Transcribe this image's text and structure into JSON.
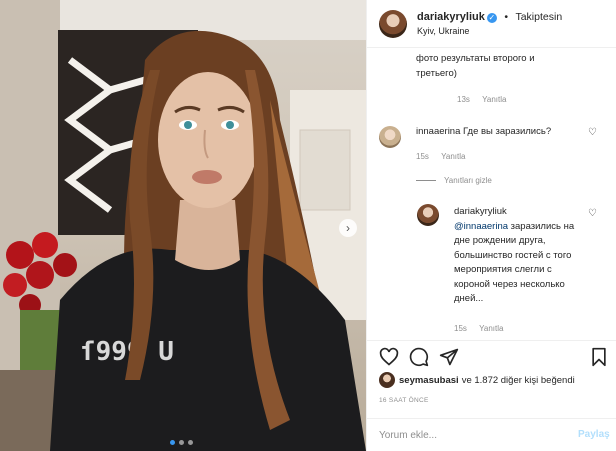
{
  "post": {
    "author": "dariakyryliuk",
    "follow_status": "Takiptesin",
    "location": "Kyiv, Ukraine"
  },
  "comments": [
    {
      "text": "фото результаты второго и третьего)",
      "time": "13s",
      "reply": "Yanıtla"
    },
    {
      "author": "innaaerina",
      "text": "Где вы заразились?",
      "time": "15s",
      "reply": "Yanıtla"
    }
  ],
  "hide_replies": "Yanıtları gizle",
  "reply_comment": {
    "author": "dariakyryliuk",
    "mention": "@innaaerina",
    "text": "заразились на дне рождении друга, большинство гостей с того мероприятия слегли с короной через несколько дней...",
    "time": "15s",
    "reply": "Yanıtla"
  },
  "likes": {
    "user": "seymasubasi",
    "text": "ve 1.872 diğer kişi beğendi"
  },
  "time_ago": "16 SAAT ÖNCE",
  "add_comment": {
    "placeholder": "Yorum ekle...",
    "post_label": "Paylaş"
  },
  "icons": [
    "verified-badge-icon",
    "heart-icon",
    "comment-icon",
    "share-icon",
    "bookmark-icon",
    "chevron-right-icon"
  ],
  "colors": {
    "link": "#00376b",
    "accent": "#3897f0",
    "muted": "#8e8e8e"
  }
}
